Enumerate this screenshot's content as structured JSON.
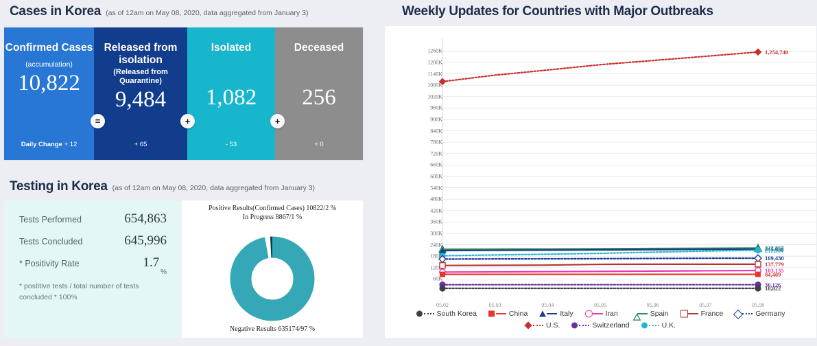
{
  "cases": {
    "title": "Cases in Korea",
    "subtitle": "(as of 12am on May 08, 2020, data aggregated from January 3)",
    "operators": [
      "=",
      "+",
      "+"
    ],
    "boxes": [
      {
        "title": "Confirmed Cases",
        "sub": "",
        "note": "(accumulation)",
        "value": "10,822",
        "delta_label": "Daily Change",
        "delta": "+ 12",
        "color": "#2877d4"
      },
      {
        "title": "Released from isolation",
        "sub": "(Released from Quarantine)",
        "note": "",
        "value": "9,484",
        "delta_label": "",
        "delta": "+ 65",
        "color": "#123c8c"
      },
      {
        "title": "Isolated",
        "sub": "",
        "note": "",
        "value": "1,082",
        "delta_label": "",
        "delta": "- 53",
        "color": "#17b6cc"
      },
      {
        "title": "Deceased",
        "sub": "",
        "note": "",
        "value": "256",
        "delta_label": "",
        "delta": "+ 0",
        "color": "#8d8d8d"
      }
    ]
  },
  "testing": {
    "title": "Testing in Korea",
    "subtitle": "(as of 12am on May 08, 2020, data aggregated from January 3)",
    "rows": [
      {
        "label": "Tests Performed",
        "value": "654,863",
        "unit": ""
      },
      {
        "label": "Tests Concluded",
        "value": "645,996",
        "unit": ""
      },
      {
        "label": "* Positivity Rate",
        "value": "1.7",
        "unit": "%"
      }
    ],
    "footnote": "* postitive tests / total number of tests concluded * 100%",
    "donut": {
      "label_top_line1": "Positive Results(Confirmed Cases) 10822/2 %",
      "label_top_line2": "In Progress 8867/1 %",
      "label_bottom": "Negative Results 635174/97 %",
      "slices": [
        {
          "name": "Negative Results",
          "value": 635174,
          "pct": 97,
          "color": "#35a8b8"
        },
        {
          "name": "Positive Results",
          "value": 10822,
          "pct": 2,
          "color": "#ffffff"
        },
        {
          "name": "In Progress",
          "value": 8867,
          "pct": 1,
          "color": "#0f3f46"
        }
      ]
    }
  },
  "chart": {
    "title": "Weekly Updates for Countries with Major Outbreaks"
  },
  "chart_data": {
    "type": "line",
    "title": "Weekly Updates for Countries with Major Outbreaks",
    "xlabel": "",
    "ylabel": "",
    "grid": true,
    "legend_position": "bottom",
    "ylim": [
      0,
      1290000
    ],
    "yticks": [
      "60K",
      "120K",
      "180K",
      "240K",
      "300K",
      "360K",
      "420K",
      "480K",
      "540K",
      "600K",
      "660K",
      "720K",
      "780K",
      "840K",
      "900K",
      "960K",
      "1020K",
      "1080K",
      "1140K",
      "1200K",
      "1260K"
    ],
    "categories": [
      "05.02",
      "05.03",
      "05.04",
      "05.05",
      "05.06",
      "05.07",
      "05.08"
    ],
    "series": [
      {
        "name": "U.S.",
        "color": "#c9302c",
        "marker": "diamond",
        "dash": "dotted",
        "values": [
          1099000,
          1133000,
          1160000,
          1188000,
          1210000,
          1232000,
          1254740
        ],
        "end_label": "1,254,740"
      },
      {
        "name": "Spain",
        "color": "#2e8b57",
        "marker": "triangle-open",
        "dash": "solid",
        "values": [
          216582,
          217466,
          218011,
          219329,
          220325,
          221447,
          222857
        ],
        "end_label": "222,857"
      },
      {
        "name": "Italy",
        "color": "#1f3c88",
        "marker": "triangle",
        "dash": "solid",
        "values": [
          209328,
          210717,
          211938,
          213013,
          214457,
          215858,
          217185
        ],
        "end_label": "215,858"
      },
      {
        "name": "U.K.",
        "color": "#22b6d4",
        "marker": "circle",
        "dash": "dotted",
        "values": [
          182260,
          186599,
          190584,
          194990,
          201101,
          206715,
          211364
        ],
        "end_label": "211,364"
      },
      {
        "name": "Germany",
        "color": "#1b3a93",
        "marker": "diamond-open",
        "dash": "dotted",
        "values": [
          164807,
          165664,
          166152,
          167007,
          168162,
          169218,
          169430
        ],
        "end_label": "169,430"
      },
      {
        "name": "France",
        "color": "#b5342f",
        "marker": "square-open",
        "dash": "solid",
        "values": [
          131287,
          131863,
          132967,
          137150,
          137779,
          137779,
          137779
        ],
        "end_label": "137,779"
      },
      {
        "name": "Iran",
        "color": "#e43ab4",
        "marker": "circle-open",
        "dash": "solid",
        "values": [
          96448,
          97424,
          98647,
          99970,
          101650,
          103135,
          104691
        ],
        "end_label": "103,135"
      },
      {
        "name": "China",
        "color": "#e8342b",
        "marker": "square",
        "dash": "solid",
        "values": [
          84385,
          84385,
          84385,
          84385,
          84385,
          84385,
          84409
        ],
        "end_label": "84,409"
      },
      {
        "name": "Switzerland",
        "color": "#6a2fa0",
        "marker": "circle",
        "dash": "dotted",
        "values": [
          29905,
          29981,
          30009,
          30060,
          30061,
          30126,
          30126
        ],
        "end_label": "30,126"
      },
      {
        "name": "South Korea",
        "color": "#3f3f46",
        "marker": "circle",
        "dash": "dotted",
        "values": [
          10780,
          10793,
          10801,
          10804,
          10806,
          10810,
          10822
        ],
        "end_label": "10,822"
      }
    ]
  }
}
